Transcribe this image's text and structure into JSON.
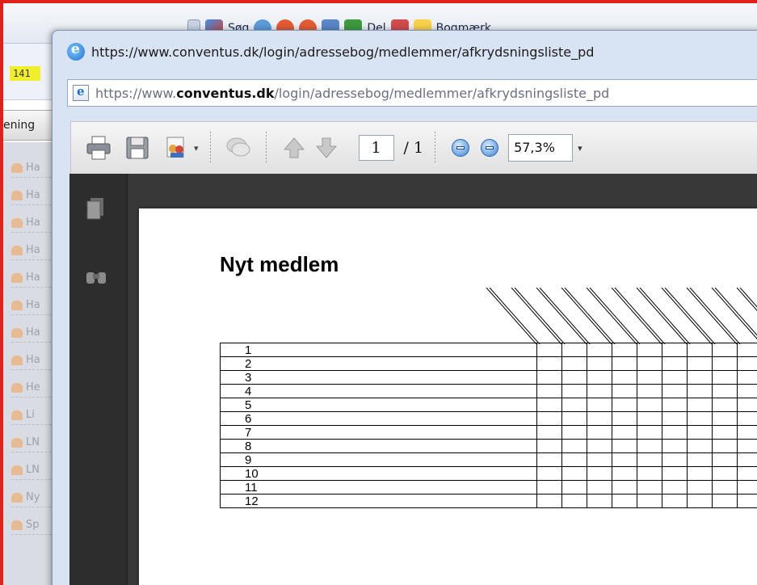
{
  "background_app": {
    "toolbar_items": [
      "Søg",
      "Del",
      "Bogmærk"
    ],
    "badge": "141",
    "tab_label": "ening",
    "list_rows": [
      "Ha",
      "Ha",
      "Ha",
      "Ha",
      "Ha",
      "Ha",
      "Ha",
      "Ha",
      "He",
      "Li",
      "LN",
      "LN",
      "Ny",
      "Sp"
    ]
  },
  "window": {
    "title": "https://www.conventus.dk/login/adressebog/medlemmer/afkrydsningsliste_pd",
    "address": {
      "scheme": "https://www.",
      "domain": "conventus.dk",
      "path": "/login/adressebog/medlemmer/afkrydsningsliste_pd"
    }
  },
  "pdf_toolbar": {
    "page_current": "1",
    "page_total": "/ 1",
    "zoom": "57,3%"
  },
  "document": {
    "title": "Nyt medlem",
    "rows": [
      "1",
      "2",
      "3",
      "4",
      "5",
      "6",
      "7",
      "8",
      "9",
      "10",
      "11",
      "12"
    ],
    "checkbox_columns": 9
  },
  "colors": {
    "frame": "#e0201b",
    "viewer": "#383838",
    "highlight": "#f2ef2a"
  }
}
